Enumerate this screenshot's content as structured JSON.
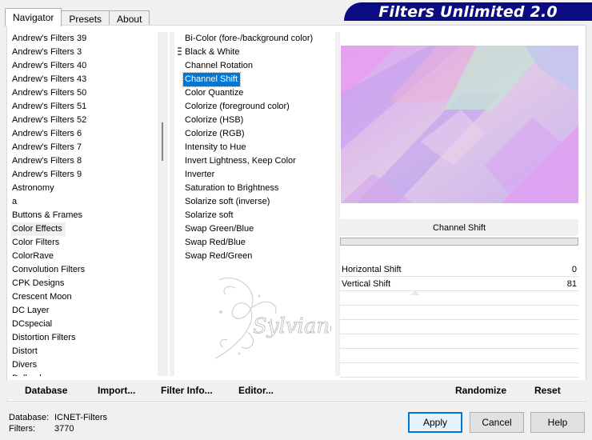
{
  "tabs": [
    {
      "label": "Navigator"
    },
    {
      "label": "Presets"
    },
    {
      "label": "About"
    }
  ],
  "banner": {
    "title": "Filters Unlimited 2.0"
  },
  "categories": [
    "Andrew's Filters 39",
    "Andrew's Filters 3",
    "Andrew's Filters 40",
    "Andrew's Filters 43",
    "Andrew's Filters 50",
    "Andrew's Filters 51",
    "Andrew's Filters 52",
    "Andrew's Filters 6",
    "Andrew's Filters 7",
    "Andrew's Filters 8",
    "Andrew's Filters 9",
    "Astronomy",
    "a",
    "Buttons & Frames",
    "Color Effects",
    "Color Filters",
    "ColorRave",
    "Convolution Filters",
    "CPK Designs",
    "Crescent Moon",
    "DC Layer",
    "DCspecial",
    "Distortion Filters",
    "Distort",
    "Divers",
    "Dollmaker"
  ],
  "selected_category": "Color Effects",
  "filters": [
    "Bi-Color (fore-/background color)",
    "Black & White",
    "Channel Rotation",
    "Channel Shift",
    "Color Quantize",
    "Colorize (foreground color)",
    "Colorize (HSB)",
    "Colorize (RGB)",
    "Intensity to Hue",
    "Invert Lightness, Keep Color",
    "Inverter",
    "Saturation to Brightness",
    "Solarize soft (inverse)",
    "Solarize soft",
    "Swap Green/Blue",
    "Swap Red/Blue",
    "Swap Red/Green"
  ],
  "selected_filter": "Channel Shift",
  "watermark_text": "Sylviane",
  "effect_name": "Channel Shift",
  "params": [
    {
      "label": "Horizontal Shift",
      "value": "0"
    },
    {
      "label": "Vertical Shift",
      "value": "81"
    }
  ],
  "bottom_buttons": {
    "database": "Database",
    "import": "Import...",
    "filter_info": "Filter Info...",
    "editor": "Editor...",
    "randomize": "Randomize",
    "reset": "Reset"
  },
  "status": {
    "database_label": "Database:",
    "database_value": "ICNET-Filters",
    "filters_label": "Filters:",
    "filters_value": "3770"
  },
  "dialog_buttons": {
    "apply": "Apply",
    "cancel": "Cancel",
    "help": "Help"
  },
  "colors": {
    "selection": "#0078d7",
    "banner": "#0c0c82"
  }
}
